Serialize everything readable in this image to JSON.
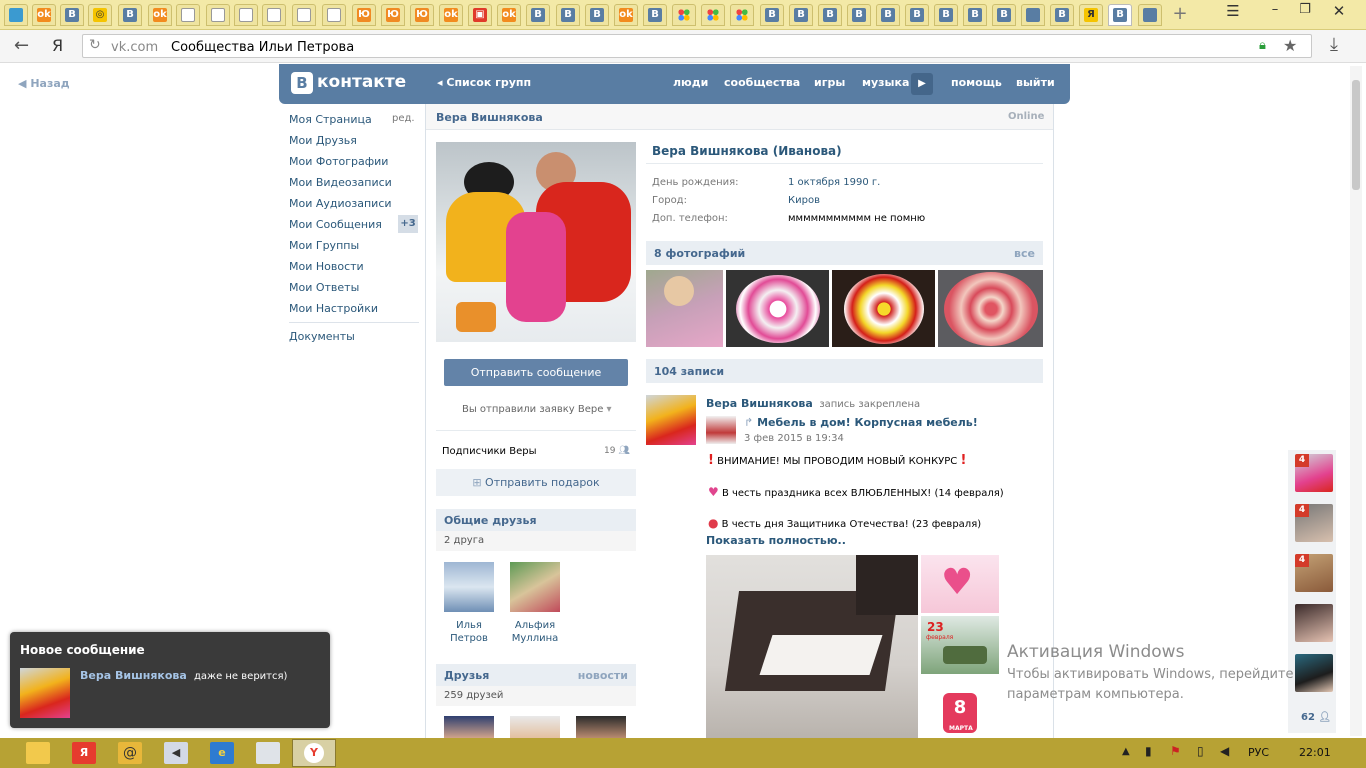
{
  "browser": {
    "tab_letters": [
      "",
      "",
      "B",
      "",
      "B",
      "",
      "",
      "",
      "",
      "",
      "",
      "",
      "",
      "",
      "B",
      "B",
      "B",
      "",
      "B",
      "",
      "",
      "",
      "B",
      "B",
      "B",
      "B",
      "B",
      "B",
      "B",
      "B",
      "B",
      "",
      "B",
      "B"
    ],
    "new_tab": "+",
    "menu_icon": "hamburger-icon",
    "url_domain": "vk.com",
    "url_title": "Сообщества Ильи Петрова",
    "yandex_letter": "Я"
  },
  "vk": {
    "back": "Назад",
    "logo_letter": "B",
    "logo_text": "контакте",
    "nav_back": "Список групп",
    "nav": [
      "люди",
      "сообщества",
      "игры",
      "музыка",
      "помощь",
      "выйти"
    ],
    "left_menu": [
      "Моя Страница",
      "Мои Друзья",
      "Мои Фотографии",
      "Мои Видеозаписи",
      "Мои Аудиозаписи",
      "Мои Сообщения",
      "Мои Группы",
      "Мои Новости",
      "Мои Ответы",
      "Мои Настройки"
    ],
    "edit": "ред.",
    "messages_badge": "+3",
    "documents": "Документы"
  },
  "profile": {
    "name_header": "Вера Вишнякова",
    "online": "Online",
    "full_name": "Вера Вишнякова (Иванова)",
    "info": [
      {
        "label": "День рождения:",
        "value": "1 октября 1990 г."
      },
      {
        "label": "Город:",
        "value": "Киров"
      },
      {
        "label": "Доп. телефон:",
        "value": "ммммммммммм не помню"
      }
    ],
    "send_message": "Отправить сообщение",
    "request_sent": "Вы отправили заявку Вере",
    "followers": "Подписчики Веры",
    "followers_count": "19",
    "send_gift": "Отправить подарок",
    "common_friends": "Общие друзья",
    "common_count": "2 друга",
    "common_list": [
      {
        "first": "Илья",
        "last": "Петров"
      },
      {
        "first": "Альфия",
        "last": "Муллина"
      }
    ],
    "friends": "Друзья",
    "friends_news": "новости",
    "friends_count": "259 друзей",
    "photos_header": "8 фотографий",
    "photos_all": "все",
    "wall_header": "104 записи"
  },
  "post": {
    "author": "Вера Вишнякова",
    "pinned": "запись закреплена",
    "repost_title": "Мебель в дом! Корпусная мебель!",
    "date": "3 фев 2015 в 19:34",
    "line1": "ВНИМАНИЕ! МЫ ПРОВОДИМ НОВЫЙ КОНКУРС",
    "line2": "В честь праздника всех ВЛЮБЛЕННЫХ! (14 февраля)",
    "line3": "В честь дня Защитника Отечества! (23 февраля)",
    "show_more": "Показать полностью..",
    "card_23": "23",
    "card_23_sub": "февраля",
    "card_8": "8",
    "card_8_sub": "МАРТА"
  },
  "notification": {
    "title": "Новое сообщение",
    "name": "Вера Вишнякова",
    "text": "даже не верится)"
  },
  "side_badges": [
    "4",
    "4",
    "4"
  ],
  "side_count": "62",
  "activation": {
    "title": "Активация Windows",
    "line1": "Чтобы активировать Windows, перейдите",
    "line2": "параметрам компьютера."
  },
  "taskbar": {
    "lang": "РУС",
    "time": "22:01"
  },
  "colors": {
    "vk_blue": "#597da3",
    "link": "#2b587a",
    "section_bg": "#e9eef3",
    "taskbar": "#b7a234",
    "tabstrip": "#f3e9a7",
    "badge_red": "#d43b2a"
  }
}
